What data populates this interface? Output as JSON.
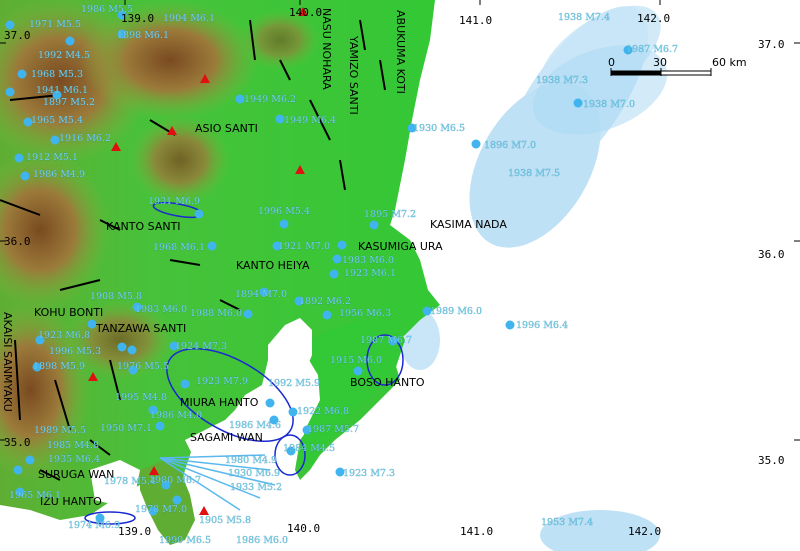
{
  "ticks": {
    "lon_top": [
      "139.0",
      "140.0",
      "141.0",
      "142.0"
    ],
    "lon_bottom": [
      "139.0",
      "140.0",
      "141.0",
      "142.0"
    ],
    "lat_left": [
      "37.0",
      "36.0",
      "35.0"
    ],
    "lat_right": [
      "37.0",
      "36.0",
      "35.0"
    ]
  },
  "scale": {
    "labels": [
      "0",
      "30",
      "60 km"
    ]
  },
  "place_labels": [
    {
      "id": "nasu-nohara",
      "text": "NASU NOHARA"
    },
    {
      "id": "yamizo-santi",
      "text": "YAMIZO SANTI"
    },
    {
      "id": "abukuma-koti",
      "text": "ABUKUMA KOTI"
    },
    {
      "id": "asio-santi",
      "text": "ASIO SANTI"
    },
    {
      "id": "kanto-santi",
      "text": "KANTO SANTI"
    },
    {
      "id": "kasima-nada",
      "text": "KASIMA NADA"
    },
    {
      "id": "kasumiga-ura",
      "text": "KASUMIGA URA"
    },
    {
      "id": "kanto-heiya",
      "text": "KANTO HEIYA"
    },
    {
      "id": "kohu-bonti",
      "text": "KOHU BONTI"
    },
    {
      "id": "tanzawa-santi",
      "text": "TANZAWA SANTI"
    },
    {
      "id": "akaisi-sanmyaku",
      "text": "AKAISI SANMYAKU"
    },
    {
      "id": "boso-hanto",
      "text": "BOSO HANTO"
    },
    {
      "id": "miura-hanto",
      "text": "MIURA HANTO"
    },
    {
      "id": "sagami-wan",
      "text": "SAGAMI WAN"
    },
    {
      "id": "suruga-wan",
      "text": "SURUGA WAN"
    },
    {
      "id": "izu-hanto",
      "text": "IZU HANTO"
    }
  ],
  "earthquakes": [
    {
      "text": "1986 M5.5"
    },
    {
      "text": "1904 M6.1"
    },
    {
      "text": "1971 M5.5"
    },
    {
      "text": "1898 M6.1"
    },
    {
      "text": "1992 M4.5"
    },
    {
      "text": "1968 M5.3"
    },
    {
      "text": "1941 M6.1"
    },
    {
      "text": "1897 M5.2"
    },
    {
      "text": "1965 M5.4"
    },
    {
      "text": "1916 M6.2"
    },
    {
      "text": "1912 M5.1"
    },
    {
      "text": "1986 M4.9"
    },
    {
      "text": "1949 M6.2"
    },
    {
      "text": "1949 M6.4"
    },
    {
      "text": "1931 M6.9"
    },
    {
      "text": "1996 M5.4"
    },
    {
      "text": "1895 M7.2"
    },
    {
      "text": "1921 M7.0"
    },
    {
      "text": "1983 M6.0"
    },
    {
      "text": "1923 M6.1"
    },
    {
      "text": "1968 M6.1"
    },
    {
      "text": "1894 M7.0"
    },
    {
      "text": "1892 M6.2"
    },
    {
      "text": "1988 M6.0"
    },
    {
      "text": "1956 M6.3"
    },
    {
      "text": "1908 M5.8"
    },
    {
      "text": "1983 M6.0"
    },
    {
      "text": "1923 M6.8"
    },
    {
      "text": "1996 M5.3"
    },
    {
      "text": "1924 M7.3"
    },
    {
      "text": "1976 M5.5"
    },
    {
      "text": "1898 M5.9"
    },
    {
      "text": "1923 M7.9"
    },
    {
      "text": "1992 M5.9"
    },
    {
      "text": "1995 M4.8"
    },
    {
      "text": "1986 M4.0"
    },
    {
      "text": "1950 M7.1"
    },
    {
      "text": "1922 M6.8"
    },
    {
      "text": "1986 M4.6"
    },
    {
      "text": "1987 M5.7"
    },
    {
      "text": "1989 M5.5"
    },
    {
      "text": "1985 M4.8"
    },
    {
      "text": "1935 M6.4"
    },
    {
      "text": "1984 M4.5"
    },
    {
      "text": "1980 M4.9"
    },
    {
      "text": "1930 M6.9"
    },
    {
      "text": "1933 M5.2"
    },
    {
      "text": "1978 M5.4"
    },
    {
      "text": "1980 M6.7"
    },
    {
      "text": "1978 M7.0"
    },
    {
      "text": "1905 M5.8"
    },
    {
      "text": "1974 M6.9"
    },
    {
      "text": "1990 M6.5"
    },
    {
      "text": "1986 M6.0"
    },
    {
      "text": "1965 M6.1"
    },
    {
      "text": "1923 M7.3"
    },
    {
      "text": "1915 M6.0"
    },
    {
      "text": "1987 M6.7"
    },
    {
      "text": "1989 M6.0"
    },
    {
      "text": "1996 M6.4"
    },
    {
      "text": "1930 M6.5"
    },
    {
      "text": "1896 M7.0"
    },
    {
      "text": "1938 M7.5"
    },
    {
      "text": "1938 M7.4"
    },
    {
      "text": "1987 M6.7"
    },
    {
      "text": "1938 M7.3"
    },
    {
      "text": "1938 M7.0"
    },
    {
      "text": "1953 M7.4"
    }
  ],
  "colors": {
    "ocean": "#ffffff",
    "plain": "#36c336",
    "hills": "#7fb43c",
    "mountain": "#8a5c28",
    "epicenter": "#3fb4ee",
    "label_cyan": "#73d3ee",
    "zone_light": "#c8e6f8",
    "zone_mid": "#a8d8f4",
    "fault": "#000000",
    "volcano": "#e01010",
    "rupture_outline": "#1a2ad0"
  }
}
